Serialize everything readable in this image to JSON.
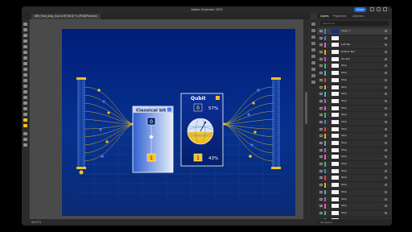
{
  "window": {
    "title": "Adobe Illustrator 2022",
    "share_label": "Share"
  },
  "document_tab": {
    "label": "IBM_Flow_blog_blue.ai @ 66.67 % (RGB/Preview)"
  },
  "status": {
    "zoom": "66.67%"
  },
  "panel": {
    "tabs": [
      "Layers",
      "Properties",
      "Libraries"
    ],
    "search_placeholder": "Search All",
    "footer": "10 Layers",
    "layers": [
      {
        "label": "Layer 1",
        "color": "#4a7bf7",
        "thumb": "dark"
      },
      {
        "label": "",
        "color": "#4a7bf7",
        "thumb": "light"
      },
      {
        "label": "Left Bar",
        "color": "#f15bb5",
        "thumb": "light"
      },
      {
        "label": "Bottom Bar",
        "color": "#f2a516",
        "thumb": "light"
      },
      {
        "label": "Top Bar",
        "color": "#c54fe0",
        "thumb": "light"
      },
      {
        "label": "Strip",
        "color": "#39c06a",
        "thumb": "light"
      },
      {
        "label": "Strip",
        "color": "#3fb3e8",
        "thumb": "light"
      },
      {
        "label": "Strip",
        "color": "#e6453c",
        "thumb": "light"
      },
      {
        "label": "Strip",
        "color": "#f2a516",
        "thumb": "light"
      },
      {
        "label": "Strip",
        "color": "#3fb3e8",
        "thumb": "light"
      },
      {
        "label": "Strip",
        "color": "#c54fe0",
        "thumb": "light"
      },
      {
        "label": "Strip",
        "color": "#f15bb5",
        "thumb": "light"
      },
      {
        "label": "Strip",
        "color": "#39c06a",
        "thumb": "light"
      },
      {
        "label": "Strip",
        "color": "#4a7bf7",
        "thumb": "light"
      },
      {
        "label": "Strip",
        "color": "#e6453c",
        "thumb": "light"
      },
      {
        "label": "Strip",
        "color": "#f2a516",
        "thumb": "light"
      },
      {
        "label": "Strip",
        "color": "#3fb3e8",
        "thumb": "light"
      },
      {
        "label": "Strip",
        "color": "#c54fe0",
        "thumb": "light"
      },
      {
        "label": "Strip",
        "color": "#f15bb5",
        "thumb": "light"
      },
      {
        "label": "Strip",
        "color": "#39c06a",
        "thumb": "light"
      },
      {
        "label": "Strip",
        "color": "#4a7bf7",
        "thumb": "light"
      },
      {
        "label": "Strip",
        "color": "#e6453c",
        "thumb": "light"
      },
      {
        "label": "Strip",
        "color": "#f2a516",
        "thumb": "light"
      },
      {
        "label": "Strip",
        "color": "#3fb3e8",
        "thumb": "light"
      },
      {
        "label": "Strip",
        "color": "#c54fe0",
        "thumb": "light"
      },
      {
        "label": "Strip",
        "color": "#f15bb5",
        "thumb": "light"
      },
      {
        "label": "Strip",
        "color": "#39c06a",
        "thumb": "light"
      },
      {
        "label": "Strip",
        "color": "#4a7bf7",
        "thumb": "light"
      },
      {
        "label": "Strip",
        "color": "#e6453c",
        "thumb": "light"
      },
      {
        "label": "Strip",
        "color": "#f2a516",
        "thumb": "light"
      }
    ]
  },
  "artwork": {
    "classical_title": "Classical bit",
    "classical_zero": "0",
    "classical_one": "1",
    "qubit_title": "Qubit",
    "qubit_zero": "0",
    "qubit_zero_pct": "57%",
    "qubit_one": "1",
    "qubit_one_pct": "43%",
    "accent_yellow": "#f6c21c",
    "accent_blue": "#3c7cff"
  }
}
